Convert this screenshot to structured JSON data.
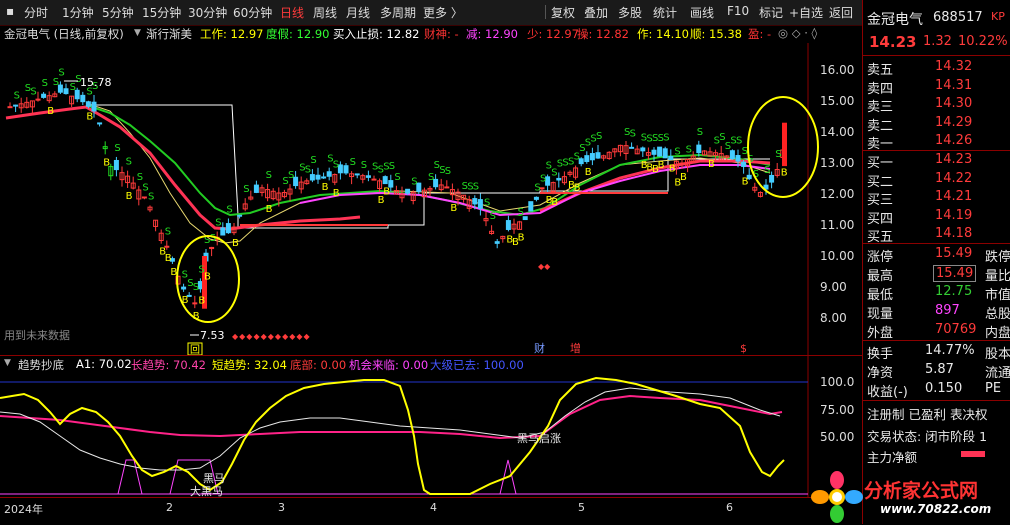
{
  "toolbar": {
    "items": [
      "分时",
      "1分钟",
      "5分钟",
      "15分钟",
      "30分钟",
      "60分钟",
      "日线",
      "周线",
      "月线",
      "多周期",
      "更多 〉"
    ],
    "active": "日线",
    "right_items": [
      "复权",
      "叠加",
      "多股",
      "统计",
      "画线",
      "F10",
      "标记",
      "+自选",
      "返回"
    ]
  },
  "title": {
    "stock": "金冠电气 (日线,前复权)",
    "indicator": "渐行渐美",
    "work_label": "工作: 12.97",
    "degree_label": "度假: 12.90",
    "buy_stop_label": "买入止损: 12.82",
    "wealth_label": "财神: -",
    "minus_label": "减: 12.90",
    "less_label": "少: 12.97",
    "up_label": "操: 12.82",
    "zuo_label": "作: 14.10",
    "shun_label": "顺: 15.38",
    "ying_label": "盈: -",
    "markers": "◎ ◇ · ◊"
  },
  "main_chart": {
    "price_axis": [
      "16.00",
      "15.00",
      "14.00",
      "13.00",
      "12.00",
      "11.00",
      "10.00",
      "9.00",
      "8.00"
    ],
    "high_label": "15.78",
    "low_label": "7.53",
    "future_data_text": "用到未来数据",
    "event_labels": [
      "财",
      "增",
      "$"
    ],
    "box_label": "回"
  },
  "sub_chart": {
    "name": "趋势抄底",
    "a1": "A1: 70.02",
    "long_trend": "长趋势: 70.42",
    "short_trend": "短趋势: 32.04",
    "bottom": "底部: 0.00",
    "opportunity": "机会来临: 0.00",
    "big_end": "大级已去: 100.00",
    "axis": [
      "100.0",
      "75.00",
      "50.00"
    ],
    "annotation1": "黑马启涨",
    "annotation2": "黑马",
    "annotation3": "大黑马"
  },
  "xaxis": {
    "labels": [
      "2024年",
      "2",
      "3",
      "4",
      "5",
      "6"
    ]
  },
  "panel": {
    "name": "金冠电气",
    "code": "688517",
    "tag": "KP",
    "price": "14.23",
    "change": "1.32",
    "pct": "10.22%",
    "asks": [
      {
        "label": "卖五",
        "price": "14.32"
      },
      {
        "label": "卖四",
        "price": "14.31"
      },
      {
        "label": "卖三",
        "price": "14.30"
      },
      {
        "label": "卖二",
        "price": "14.29"
      },
      {
        "label": "卖一",
        "price": "14.26"
      }
    ],
    "bids": [
      {
        "label": "买一",
        "price": "14.23"
      },
      {
        "label": "买二",
        "price": "14.22"
      },
      {
        "label": "买三",
        "price": "14.21"
      },
      {
        "label": "买四",
        "price": "14.19"
      },
      {
        "label": "买五",
        "price": "14.18"
      }
    ],
    "stats": [
      {
        "label": "涨停",
        "value": "15.49",
        "extra": "跌停"
      },
      {
        "label": "最高",
        "value": "15.49",
        "extra": "量比"
      },
      {
        "label": "最低",
        "value": "12.75",
        "extra": "市值"
      },
      {
        "label": "现量",
        "value": "897",
        "extra": "总股"
      },
      {
        "label": "外盘",
        "value": "70769",
        "extra": "内盘"
      }
    ],
    "stats2": [
      {
        "label": "换手",
        "value": "14.77%",
        "extra": "股本"
      },
      {
        "label": "净资",
        "value": "5.87",
        "extra": "流通"
      },
      {
        "label": "收益(-)",
        "value": "0.150",
        "extra": "PE"
      }
    ],
    "regs": "注册制 已盈利 表决权",
    "trade_state": "交易状态: 闭市阶段 1",
    "net_flow": "主力净额"
  },
  "watermark": {
    "text": "分析家公式网",
    "url": "www.70822.com"
  }
}
